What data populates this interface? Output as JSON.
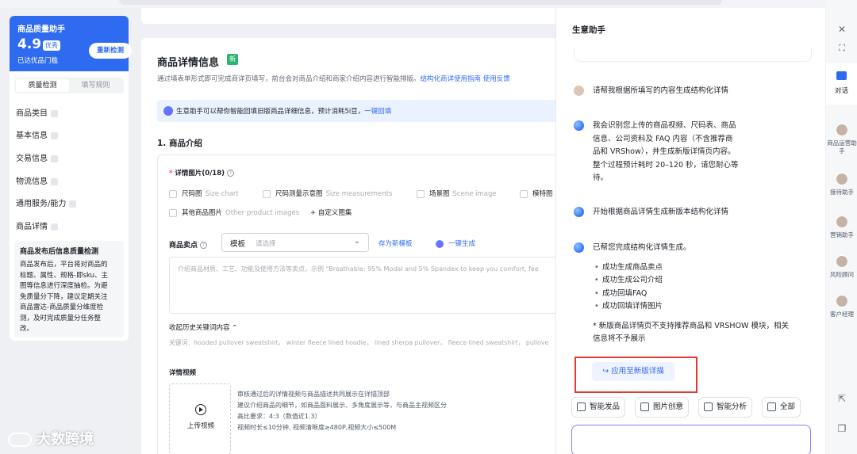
{
  "left": {
    "quality_card": {
      "title": "商品质量助手",
      "score": "4.9",
      "level": "优秀",
      "subtitle": "已达优品门槛",
      "recheck": "重新检测"
    },
    "tabs": [
      "质量检测",
      "填写规则"
    ],
    "nav": [
      "商品类目",
      "基本信息",
      "交易信息",
      "物流信息",
      "通用服务/能力",
      "商品详情"
    ],
    "notice": {
      "title": "商品发布后信息质量检测",
      "lines": [
        "商品发布后，平台将对商品的",
        "标题、属性、规格-即sku、主",
        "图等信息进行深度抽检。为避",
        "免质量分下降，建议定期关注",
        "商品雷达-商品质量分维度检",
        "测，及时完成质量分任务整",
        "改。"
      ]
    }
  },
  "main": {
    "title": "商品详情信息",
    "new_badge": "新",
    "desc": "通过填表单形式即可完成商详页填写，前台会对商品介绍和商家介绍内容进行智能排版。",
    "desc_links": [
      "结构化商详使用指南",
      "使用反馈"
    ],
    "ai_tip": "生意助手可以帮你智能回填旧版商品详细信息，预计消耗5i豆，",
    "ai_tip_link": "一键回填",
    "section": "1. 商品介绍",
    "detail_images_label": "详情图片(0/18)",
    "checkboxes": [
      {
        "cn": "尺码图",
        "en": "Size chart"
      },
      {
        "cn": "尺码测量示意图",
        "en": "Size measurements"
      },
      {
        "cn": "场景图",
        "en": "Scene image"
      },
      {
        "cn": "模特图",
        "en": ""
      },
      {
        "cn": "其他商品图片",
        "en": "Other product images"
      }
    ],
    "add_custom": "+ 自定义图集",
    "selling_label": "商品卖点",
    "template_value": "模板",
    "template_placeholder": "请选择",
    "save_template": "存为新模板",
    "one_click": "一键生成",
    "textarea_placeholder": "介绍商品材质、工艺、功能及使用方法等卖点，示例 \"Breathable: 95% Modal and 5% Spandex to keep you comfort, fee",
    "collapse_history": "收起历史关键词内容",
    "keywords": "关键词：hooded pullover sweatshirt，  winter fleece lined hoodie，  lined sherpa pullover，  fleece lined sweatshirt，  pullove",
    "video_title": "详情视频",
    "upload_label": "上传视频",
    "video_desc": [
      "审核通过后的详情视频与商品描述共同展示在详描顶部",
      "建议介绍商品的细节，如商品面料展示、多角度展示等，与商品主视频区分",
      "高比要求：4:3（数值近1.3）",
      "视频时长≤10分钟, 视频清晰度≥480P,视频大小≤500M"
    ]
  },
  "assistant": {
    "title": "生意助手",
    "user_msg": "请帮我根据所填写的内容生成结构化详情",
    "ai_msg1": [
      "我会识别您上传的商品视频、尺码表、商品",
      "信息、公司资料及 FAQ 内容（不含推荐商",
      "品和 VRShow），并生成新版详情页内容。",
      "整个过程预计耗时 20–120 秒，请您耐心等",
      "待。"
    ],
    "ai_msg2": "开始根据商品详情生成新版本结构化详情",
    "ai_msg3": "已帮您完成结构化详情生成。",
    "results": [
      "成功生成商品卖点",
      "成功生成公司介绍",
      "成功回填FAQ",
      "成功回填详情图片"
    ],
    "note": [
      "* 新版商品详情页不支持推荐商品和 VRSHOW 模块，相关",
      "信息将不予展示"
    ],
    "apply_button": "↪ 应用至新版详描",
    "chips": [
      "智能发品",
      "图片创意",
      "智能分析",
      "全部"
    ]
  },
  "sidebar": {
    "dialog_label": "对话",
    "agents": [
      "商品运营助手",
      "接待助手",
      "营销助手",
      "风险顾问",
      "客户经理"
    ]
  },
  "watermark": "大数跨境",
  "colors": {
    "accent": "#2f6bf1",
    "highlight": "#e53935",
    "success": "#2bb56e"
  }
}
